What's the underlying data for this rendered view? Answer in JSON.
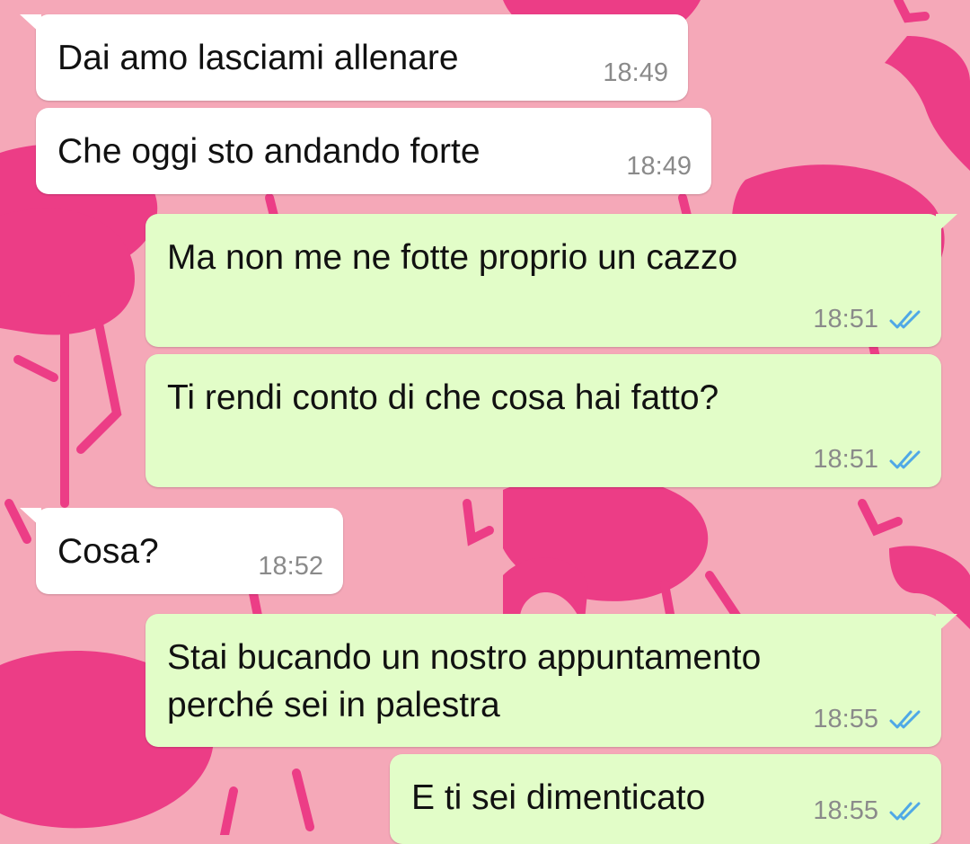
{
  "colors": {
    "wallpaper": "#f5a8b8",
    "flamingo": "#ec3d86",
    "incoming_bubble": "#ffffff",
    "outgoing_bubble": "#e2fdc8",
    "read_ticks": "#4fa8e6",
    "timestamp": "#8a8a8a"
  },
  "wallpaper": {
    "pattern": "flamingo"
  },
  "messages": [
    {
      "direction": "incoming",
      "text": "Dai amo lasciami allenare",
      "time": "18:49"
    },
    {
      "direction": "incoming",
      "text": "Che oggi sto andando forte",
      "time": "18:49"
    },
    {
      "direction": "outgoing",
      "text": "Ma non me ne fotte proprio un cazzo",
      "time": "18:51",
      "status": "read-ticks-icon"
    },
    {
      "direction": "outgoing",
      "text": "Ti rendi conto di che cosa hai fatto?",
      "time": "18:51",
      "status": "read-ticks-icon"
    },
    {
      "direction": "incoming",
      "text": "Cosa?",
      "time": "18:52"
    },
    {
      "direction": "outgoing",
      "text": "Stai bucando un nostro appuntamento\nperché sei in palestra",
      "time": "18:55",
      "status": "read-ticks-icon"
    },
    {
      "direction": "outgoing",
      "text": "E ti sei dimenticato",
      "time": "18:55",
      "status": "read-ticks-icon"
    }
  ]
}
